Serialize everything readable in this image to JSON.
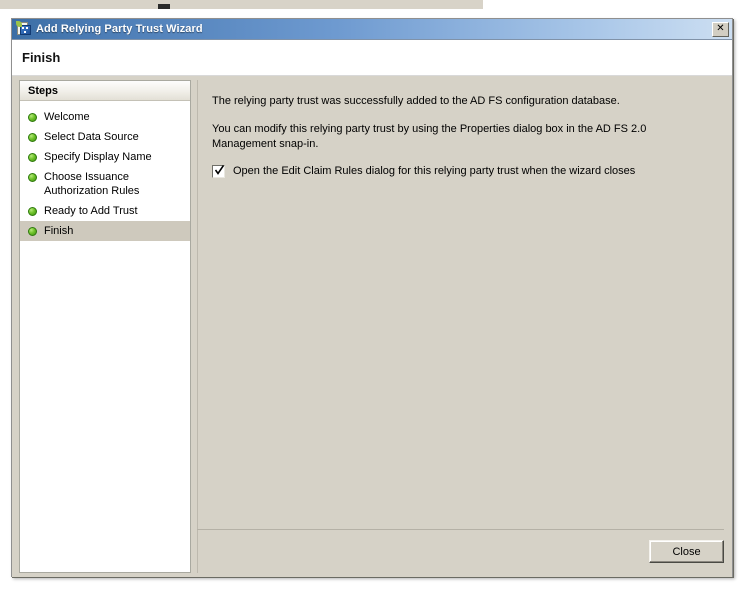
{
  "window": {
    "title": "Add Relying Party Trust Wizard",
    "icon": "wizard-certificate-icon",
    "close_glyph": "✕",
    "page_title": "Finish"
  },
  "steps_panel": {
    "header": "Steps",
    "items": [
      {
        "label": "Welcome",
        "current": false
      },
      {
        "label": "Select Data Source",
        "current": false
      },
      {
        "label": "Specify Display Name",
        "current": false
      },
      {
        "label": "Choose Issuance Authorization Rules",
        "current": false
      },
      {
        "label": "Ready to Add Trust",
        "current": false
      },
      {
        "label": "Finish",
        "current": true
      }
    ]
  },
  "content": {
    "paragraph1": "The relying party trust was successfully added to the AD FS configuration database.",
    "paragraph2": "You can modify this relying party trust by using the Properties dialog box in the AD FS 2.0 Management snap-in.",
    "checkbox": {
      "label": "Open the Edit Claim Rules dialog for this relying party trust when the wizard closes",
      "checked": true
    }
  },
  "footer": {
    "close_label": "Close"
  },
  "colors": {
    "titlebar_start": "#3b6ea5",
    "titlebar_end": "#cddff2",
    "window_face": "#d6d2c7",
    "panel_white": "#ffffff",
    "step_bullet_green": "#6fc32a",
    "current_step_highlight": "#cec9bd",
    "desktop_strip": "#d8d3c8"
  }
}
